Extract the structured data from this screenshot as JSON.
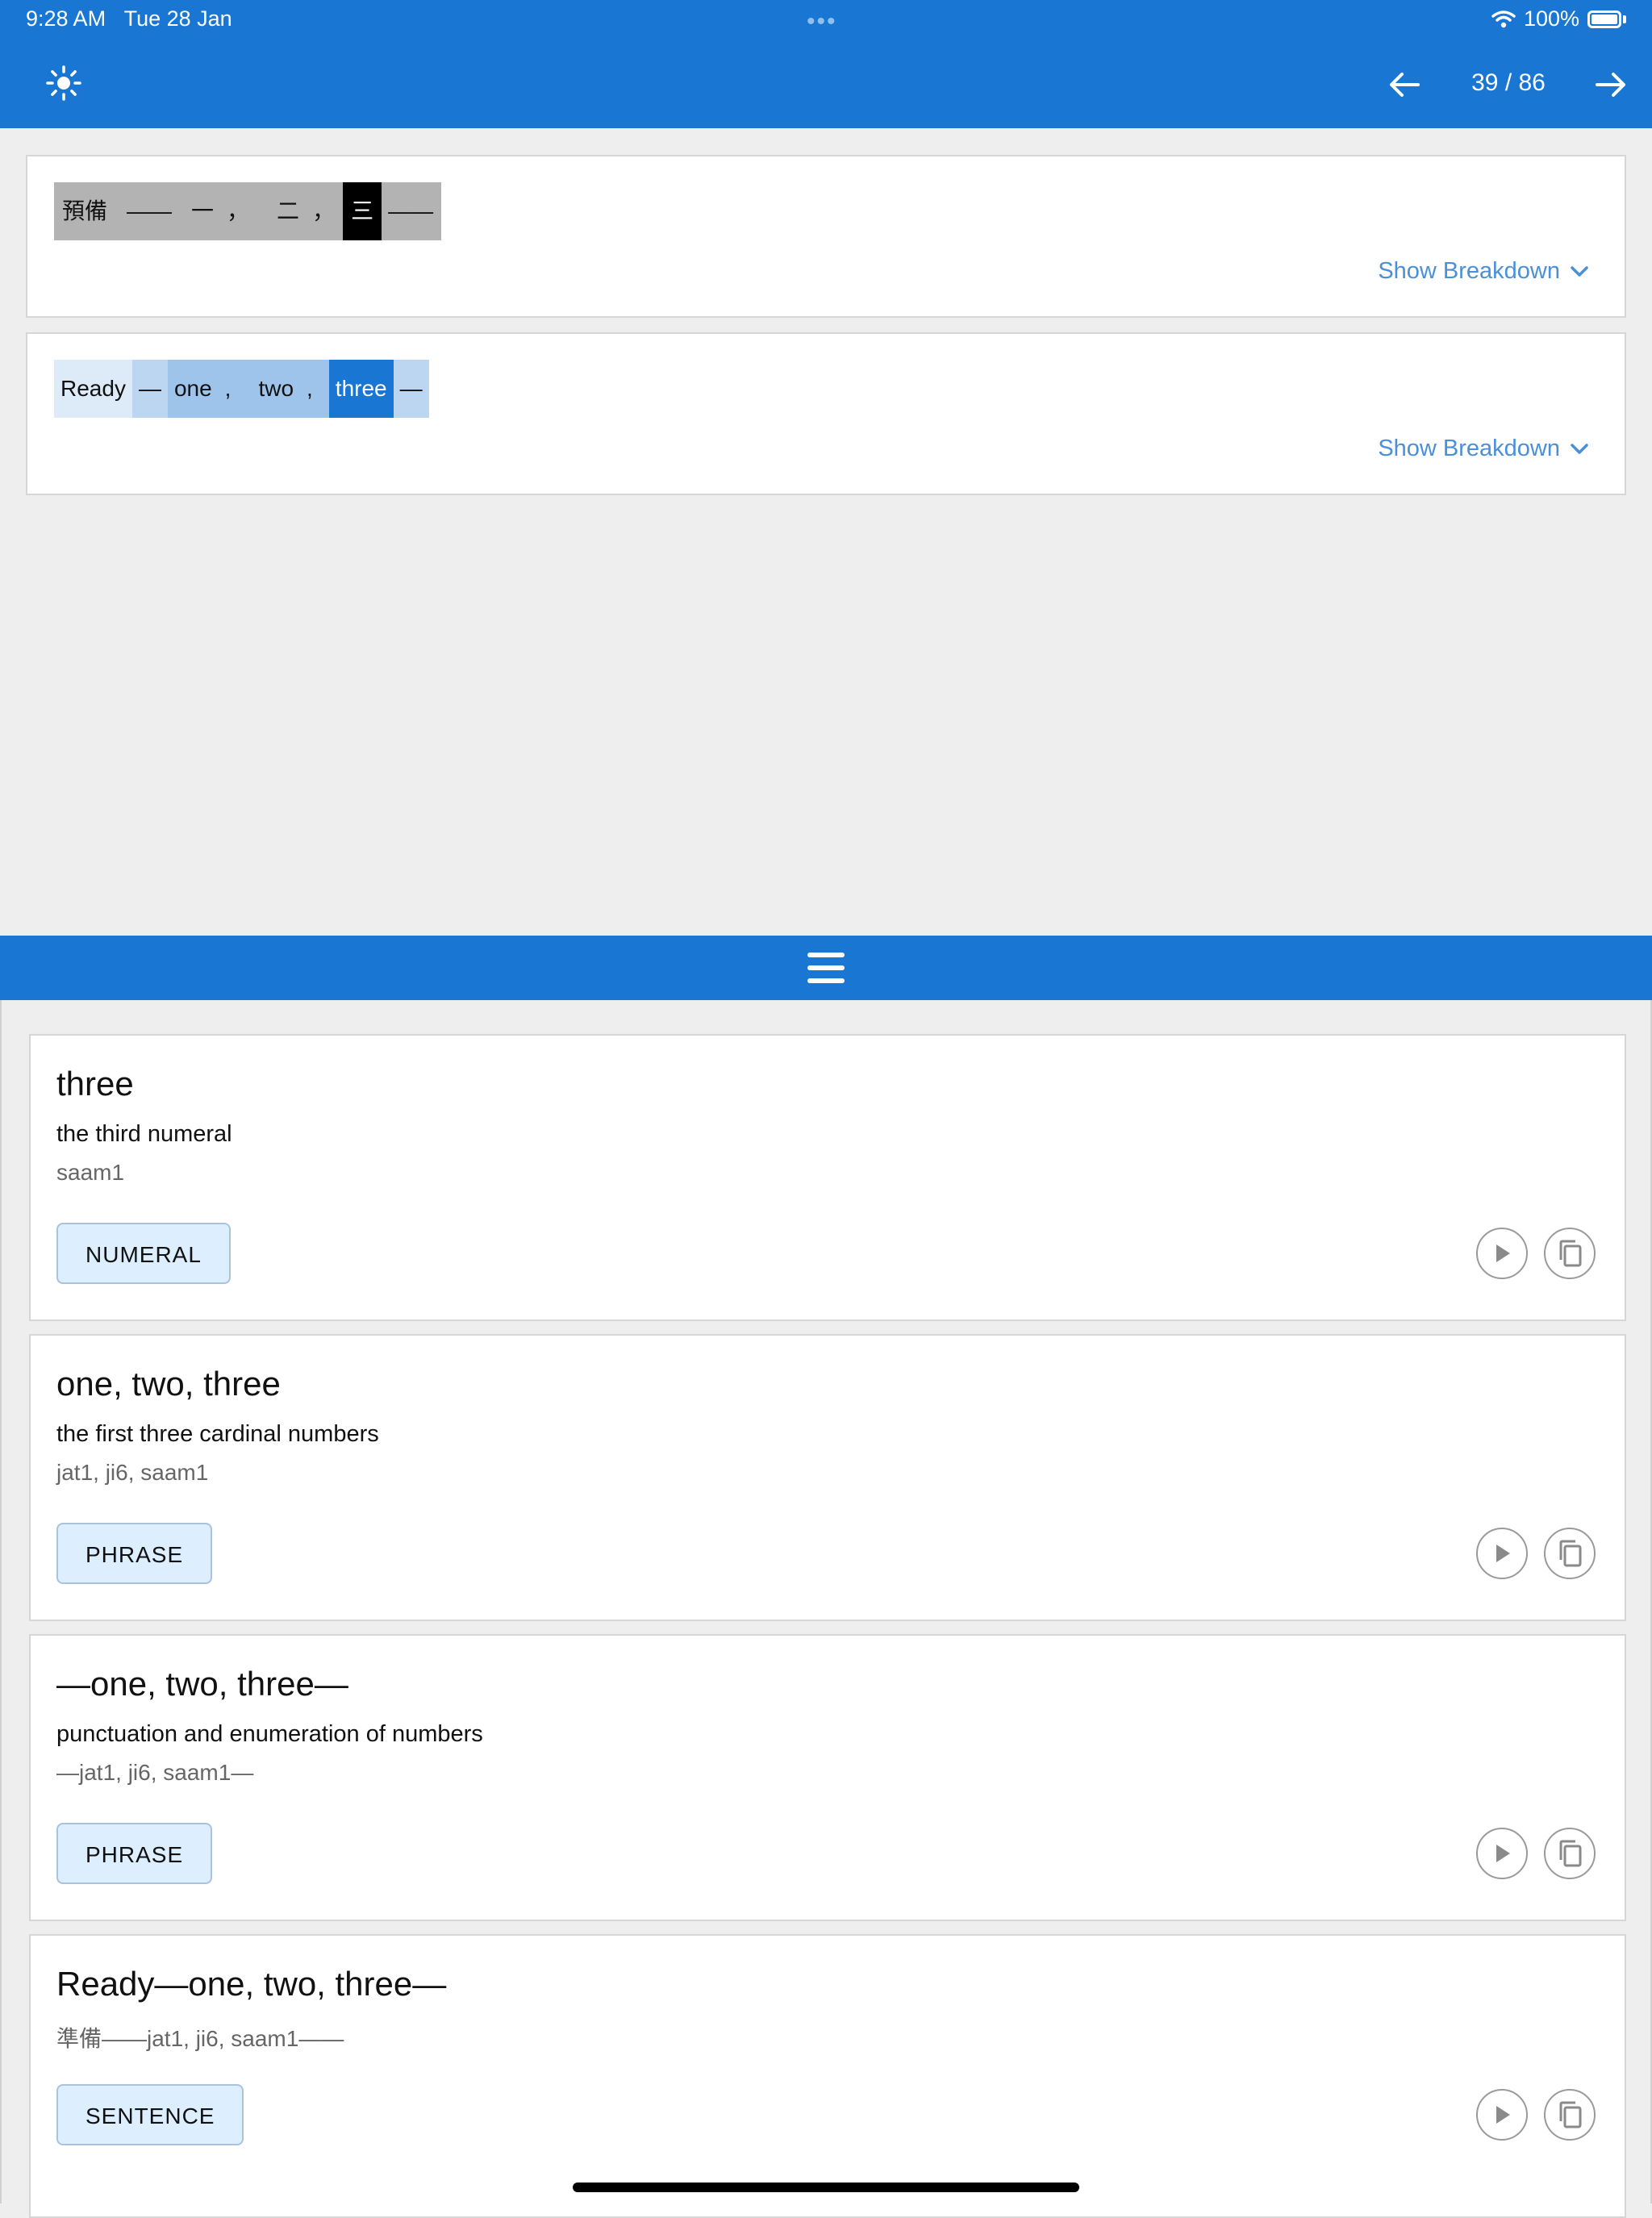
{
  "status": {
    "time": "9:28 AM",
    "date": "Tue 28 Jan",
    "dots": "•••",
    "battery": "100%"
  },
  "nav": {
    "counter": "39 / 86"
  },
  "sentences": [
    {
      "tokens": [
        "預備",
        "——",
        "一",
        "，",
        "二",
        "，",
        "三",
        "——"
      ],
      "breakdown_label": "Show Breakdown"
    },
    {
      "tokens": [
        "Ready",
        "—",
        "one",
        ",",
        "two",
        ",",
        "three",
        "—"
      ],
      "breakdown_label": "Show Breakdown"
    }
  ],
  "entries": [
    {
      "title": "three",
      "definition": "the third numeral",
      "romanization": "saam1",
      "badge": "NUMERAL"
    },
    {
      "title": "one, two, three",
      "definition": "the first three cardinal numbers",
      "romanization": "jat1, ji6, saam1",
      "badge": "PHRASE"
    },
    {
      "title": "—one, two, three—",
      "definition": "punctuation and enumeration of numbers",
      "romanization": "—jat1, ji6, saam1—",
      "badge": "PHRASE"
    },
    {
      "title": "Ready—one, two, three—",
      "romanization": "準備——jat1, ji6, saam1——",
      "badge": "SENTENCE"
    }
  ],
  "colors": {
    "primary": "#1976d2",
    "link": "#4a90d9",
    "badge_bg": "#ddeeff"
  }
}
